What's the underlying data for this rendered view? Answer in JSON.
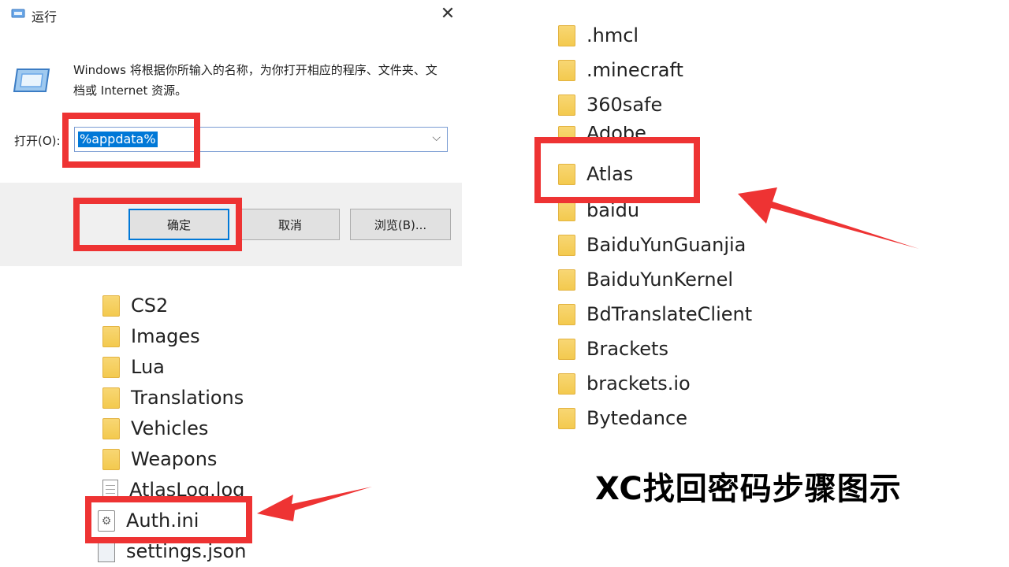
{
  "run_dialog": {
    "title": "运行",
    "description": "Windows 将根据你所输入的名称，为你打开相应的程序、文件夹、文档或 Internet 资源。",
    "open_label": "打开(O):",
    "input_value": "%appdata%",
    "ok_label": "确定",
    "cancel_label": "取消",
    "browse_label": "浏览(B)..."
  },
  "folder_list_right": [
    {
      "name": ".hmcl",
      "type": "folder"
    },
    {
      "name": ".minecraft",
      "type": "folder"
    },
    {
      "name": "360safe",
      "type": "folder"
    },
    {
      "name": "Adobe",
      "type": "folder"
    },
    {
      "name": "Atlas",
      "type": "folder"
    },
    {
      "name": "baidu",
      "type": "folder"
    },
    {
      "name": "BaiduYunGuanjia",
      "type": "folder"
    },
    {
      "name": "BaiduYunKernel",
      "type": "folder"
    },
    {
      "name": "BdTranslateClient",
      "type": "folder"
    },
    {
      "name": "Brackets",
      "type": "folder"
    },
    {
      "name": "brackets.io",
      "type": "folder"
    },
    {
      "name": "Bytedance",
      "type": "folder"
    }
  ],
  "file_list_left": [
    {
      "name": "CS2",
      "type": "folder"
    },
    {
      "name": "Images",
      "type": "folder"
    },
    {
      "name": "Lua",
      "type": "folder"
    },
    {
      "name": "Translations",
      "type": "folder"
    },
    {
      "name": "Vehicles",
      "type": "folder"
    },
    {
      "name": "Weapons",
      "type": "folder"
    },
    {
      "name": "AtlasLog.log",
      "type": "file"
    },
    {
      "name": "Auth.ini",
      "type": "ini"
    },
    {
      "name": "settings.json",
      "type": "json"
    }
  ],
  "caption": "XC找回密码步骤图示",
  "colors": {
    "highlight": "#ee3333",
    "accent": "#0078d7"
  }
}
